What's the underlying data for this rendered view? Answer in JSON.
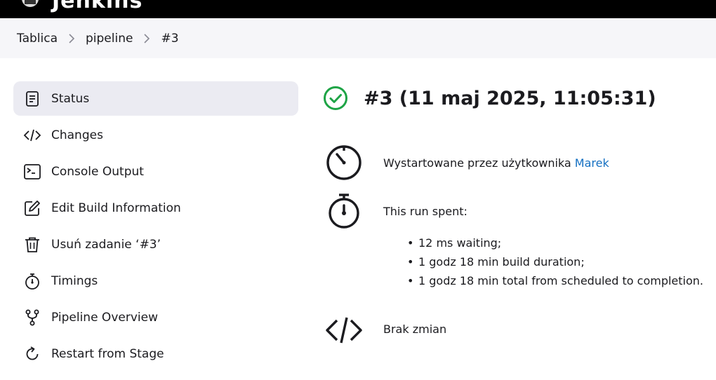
{
  "header": {
    "brand": "Jenkins",
    "logo_icon": "jenkins-butler-icon"
  },
  "breadcrumbs": [
    {
      "label": "Tablica"
    },
    {
      "label": "pipeline"
    },
    {
      "label": "#3"
    }
  ],
  "sidebar": {
    "items": [
      {
        "label": "Status",
        "icon": "document-icon",
        "active": true
      },
      {
        "label": "Changes",
        "icon": "code-icon"
      },
      {
        "label": "Console Output",
        "icon": "terminal-icon"
      },
      {
        "label": "Edit Build Information",
        "icon": "edit-icon"
      },
      {
        "label": "Usuń zadanie ‘#3’",
        "icon": "trash-icon"
      },
      {
        "label": "Timings",
        "icon": "stopwatch-icon"
      },
      {
        "label": "Pipeline Overview",
        "icon": "branch-icon"
      },
      {
        "label": "Restart from Stage",
        "icon": "restart-icon"
      }
    ]
  },
  "main": {
    "title": "#3 (11 maj 2025, 11:05:31)",
    "status": "success",
    "status_color": "#1ea446",
    "started_by": {
      "prefix": "Wystartowane przez użytkownika ",
      "user": "Marek",
      "link_color": "#1570c2"
    },
    "run_spent": {
      "heading": "This run spent:",
      "items": [
        "12 ms waiting;",
        "1 godz 18 min build duration;",
        "1 godz 18 min total from scheduled to completion."
      ]
    },
    "changes": {
      "text": "Brak zmian"
    }
  }
}
